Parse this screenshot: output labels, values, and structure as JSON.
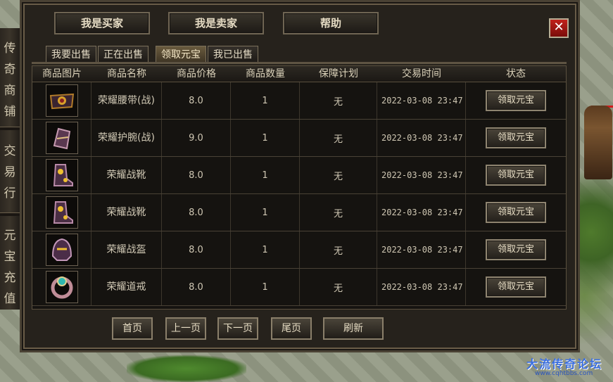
{
  "window": {
    "top_buttons": [
      "我是买家",
      "我是卖家",
      "帮助"
    ],
    "close_label": "✕"
  },
  "side_menu": {
    "groups": [
      [
        "传",
        "奇",
        "商",
        "铺"
      ],
      [
        "交",
        "易",
        "行"
      ],
      [
        "元",
        "宝",
        "充",
        "值"
      ]
    ]
  },
  "tabs": [
    {
      "label": "我要出售",
      "active": false
    },
    {
      "label": "正在出售",
      "active": false
    },
    {
      "label": "领取元宝",
      "active": true
    },
    {
      "label": "我已出售",
      "active": false
    }
  ],
  "table": {
    "headers": [
      "商品图片",
      "商品名称",
      "商品价格",
      "商品数量",
      "保障计划",
      "交易时间",
      "状态"
    ],
    "rows": [
      {
        "icon": "belt-icon",
        "name": "荣耀腰带(战)",
        "price": "8.0",
        "qty": "1",
        "guarantee": "无",
        "time": "2022-03-08 23:47",
        "action": "领取元宝"
      },
      {
        "icon": "bracer-icon",
        "name": "荣耀护腕(战)",
        "price": "9.0",
        "qty": "1",
        "guarantee": "无",
        "time": "2022-03-08 23:47",
        "action": "领取元宝"
      },
      {
        "icon": "boots-icon",
        "name": "荣耀战靴",
        "price": "8.0",
        "qty": "1",
        "guarantee": "无",
        "time": "2022-03-08 23:47",
        "action": "领取元宝"
      },
      {
        "icon": "boots-icon",
        "name": "荣耀战靴",
        "price": "8.0",
        "qty": "1",
        "guarantee": "无",
        "time": "2022-03-08 23:47",
        "action": "领取元宝"
      },
      {
        "icon": "helmet-icon",
        "name": "荣耀战盔",
        "price": "8.0",
        "qty": "1",
        "guarantee": "无",
        "time": "2022-03-08 23:47",
        "action": "领取元宝"
      },
      {
        "icon": "ring-icon",
        "name": "荣耀道戒",
        "price": "8.0",
        "qty": "1",
        "guarantee": "无",
        "time": "2022-03-08 23:47",
        "action": "领取元宝"
      }
    ]
  },
  "pager": [
    "首页",
    "上一页",
    "下一页",
    "尾页",
    "刷新"
  ],
  "watermark": {
    "title": "大流传奇论坛",
    "url": "www.cqhtbbs.com"
  },
  "colors": {
    "accent": "#c0211b",
    "text": "#e6dcc4",
    "panel": "#26221c"
  }
}
